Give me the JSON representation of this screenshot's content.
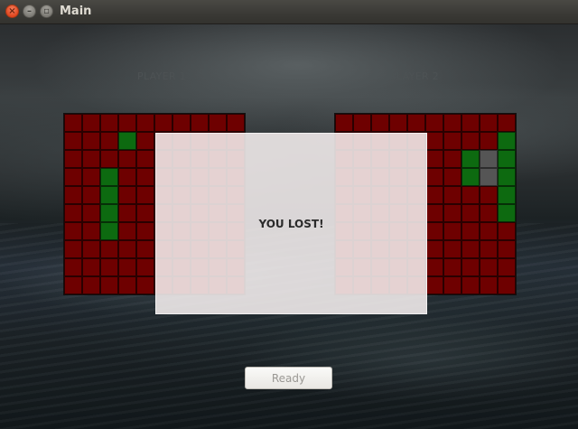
{
  "window": {
    "title": "Main",
    "buttons": [
      {
        "name": "close",
        "glyph": "×"
      },
      {
        "name": "minimize",
        "glyph": "–"
      },
      {
        "name": "maximize",
        "glyph": "▫"
      }
    ]
  },
  "players": {
    "p1_label": "PLAYER 1",
    "p2_label": "PLAYER 2"
  },
  "cell_states": {
    "e": "empty",
    "s": "ship",
    "d": "hit"
  },
  "colors": {
    "empty": "#6e0000",
    "ship": "#0d6a10",
    "hit": "#555555",
    "background": "#1d2326"
  },
  "board1": [
    "eeeeeeeeee",
    "eeeseeeeee",
    "eeeeeeeeee",
    "eeseeeeeee",
    "eeseeeeeee",
    "eeseeeeeee",
    "eeseeeeeee",
    "eeeeeeeeee",
    "eeeeeeeeee",
    "eeeeeeeeee"
  ],
  "board2": [
    "eeeeeeeeee",
    "eeeeeeeees",
    "eeeeeeesds",
    "eeeeeeesds",
    "eeeeeeeees",
    "eeeeeeeees",
    "eeeeeeeeee",
    "eeeeeeeeee",
    "eeeeeeeeee",
    "eeeeeeeeee"
  ],
  "dialog": {
    "message": "YOU LOST!"
  },
  "footer": {
    "ready_label": "Ready"
  }
}
